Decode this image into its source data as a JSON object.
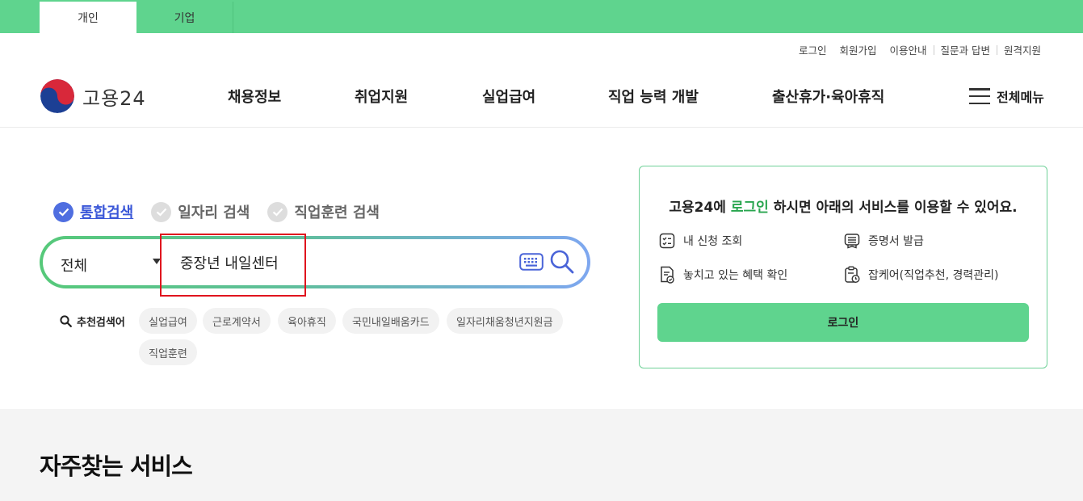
{
  "top_tabs": [
    {
      "label": "개인",
      "active": true
    },
    {
      "label": "기업",
      "active": false
    }
  ],
  "util_links": [
    "로그인",
    "회원가입",
    "이용안내",
    "질문과 답변",
    "원격지원"
  ],
  "logo": {
    "text": "고용24"
  },
  "nav": [
    "채용정보",
    "취업지원",
    "실업급여",
    "직업 능력 개발",
    "출산휴가·육아휴직"
  ],
  "all_menu": {
    "label": "전체메뉴",
    "icon": "hamburger-icon"
  },
  "search_types": [
    {
      "label": "통합검색",
      "active": true
    },
    {
      "label": "일자리 검색",
      "active": false
    },
    {
      "label": "직업훈련 검색",
      "active": false
    }
  ],
  "search": {
    "scope": "전체",
    "value": "중장년 내일센터",
    "keyboard_icon": "keyboard-icon",
    "search_icon": "search-icon"
  },
  "recommended": {
    "title": "추천검색어",
    "keywords": [
      "실업급여",
      "근로계약서",
      "육아휴직",
      "국민내일배움카드",
      "일자리채움청년지원금",
      "직업훈련"
    ]
  },
  "login_card": {
    "msg_prefix": "고용24에 ",
    "msg_highlight": "로그인",
    "msg_suffix": " 하시면 아래의 서비스를 이용할 수 있어요.",
    "services": [
      {
        "label": "내 신청 조회",
        "icon": "checklist-icon"
      },
      {
        "label": "증명서 발급",
        "icon": "certificate-icon"
      },
      {
        "label": "놓치고 있는 혜택 확인",
        "icon": "benefit-doc-icon"
      },
      {
        "label": "잡케어(직업추천, 경력관리)",
        "icon": "clipboard-clock-icon"
      }
    ],
    "button_label": "로그인"
  },
  "colors": {
    "brand_green": "#5fd48e",
    "highlight_green": "#29a64f",
    "active_blue": "#3a57d8"
  },
  "frequent_services": {
    "title": "자주찾는 서비스"
  }
}
